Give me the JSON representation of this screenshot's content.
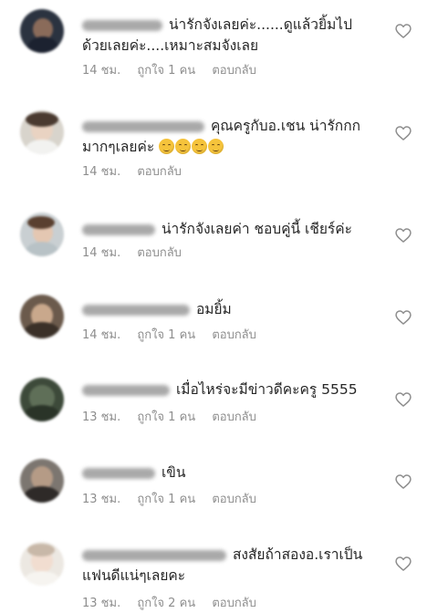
{
  "comments": [
    {
      "text_line1": "น่ารักจังเลยค่ะ......ดูแล้วยิ้มไป",
      "text_line2": "ด้วยเลยค่ะ....เหมาะสมจังเลย",
      "time": "14 ชม.",
      "likes": "ถูกใจ 1 คน",
      "reply": "ตอบกลับ"
    },
    {
      "text_line1": "คุณครูกับอ.เชน น่ารักกก",
      "text_line2": "มากๆเลยค่ะ",
      "time": "14 ชม.",
      "likes": "",
      "reply": "ตอบกลับ"
    },
    {
      "text_line1": "น่ารักจังเลยค่า ชอบคู่นี้ เชียร์ค่ะ",
      "time": "14 ชม.",
      "likes": "",
      "reply": "ตอบกลับ"
    },
    {
      "text_line1": "อมยิ้ม",
      "time": "14 ชม.",
      "likes": "ถูกใจ 1 คน",
      "reply": "ตอบกลับ"
    },
    {
      "text_line1": "เมื่อไหร่จะมีข่าวดีคะครู  5555",
      "time": "13 ชม.",
      "likes": "ถูกใจ 1 คน",
      "reply": "ตอบกลับ"
    },
    {
      "text_line1": "เขิน",
      "time": "13 ชม.",
      "likes": "ถูกใจ 1 คน",
      "reply": "ตอบกลับ"
    },
    {
      "text_line1": "สงสัยถ้าสองอ.เราเป็น",
      "text_line2": "แฟนดีแน่ๆเลยคะ",
      "time": "13 ชม.",
      "likes": "ถูกใจ 2 คน",
      "reply": "ตอบกลับ"
    }
  ],
  "colors": {
    "text": "#262626",
    "meta": "#8e8e8e",
    "heart": "#8e8e8e"
  },
  "icons": {
    "like": "heart-outline-icon",
    "emoji": "smiling-face-emoji"
  }
}
